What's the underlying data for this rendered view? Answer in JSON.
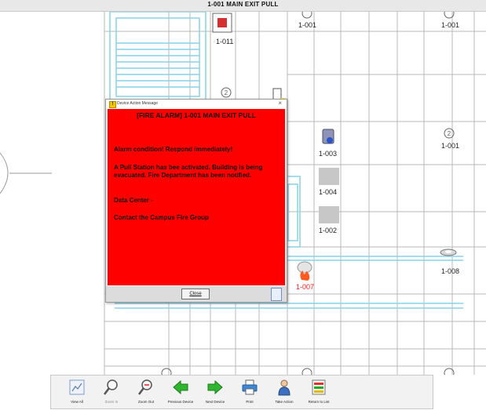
{
  "window": {
    "title": "1-001  MAIN EXIT PULL"
  },
  "floorplan": {
    "device_labels": {
      "d1011": "1-011",
      "d1001_top": "1-001",
      "d1001_right_top": "1-001",
      "d1001_right_mid": "1-001",
      "d1003": "1-003",
      "d1004": "1-004",
      "d1002": "1-002",
      "d1007": "1-007",
      "d1008": "1-008"
    }
  },
  "dialog": {
    "title": "Device Action Message",
    "close": "×",
    "heading": "[FIRE ALARM] 1-001 MAIN EXIT PULL",
    "paragraphs": [
      "Alarm condition!  Respond immediately!",
      "A Pull Station has bee activated. Building is being evacuated. Fire Department has been notified.",
      "Data Center -",
      "Contact the Campus Fire Group"
    ],
    "close_button": "Close"
  },
  "toolbar": {
    "buttons": [
      {
        "label": "View All",
        "icon": "view-all-icon",
        "enabled": true
      },
      {
        "label": "Zoom In",
        "icon": "zoom-in-icon",
        "enabled": false
      },
      {
        "label": "Zoom Out",
        "icon": "zoom-out-icon",
        "enabled": true
      },
      {
        "label": "Previous Device",
        "icon": "left-arrow-icon",
        "enabled": true
      },
      {
        "label": "Next Device",
        "icon": "right-arrow-icon",
        "enabled": true
      },
      {
        "label": "Print",
        "icon": "printer-icon",
        "enabled": true
      },
      {
        "label": "Take Action",
        "icon": "person-icon",
        "enabled": true
      },
      {
        "label": "Return to List",
        "icon": "list-icon",
        "enabled": true
      }
    ]
  },
  "colors": {
    "alarm": "#ff0000",
    "arrow": "#22aa22",
    "walls": "#7fd3e6",
    "grid": "#b5b5b5"
  }
}
